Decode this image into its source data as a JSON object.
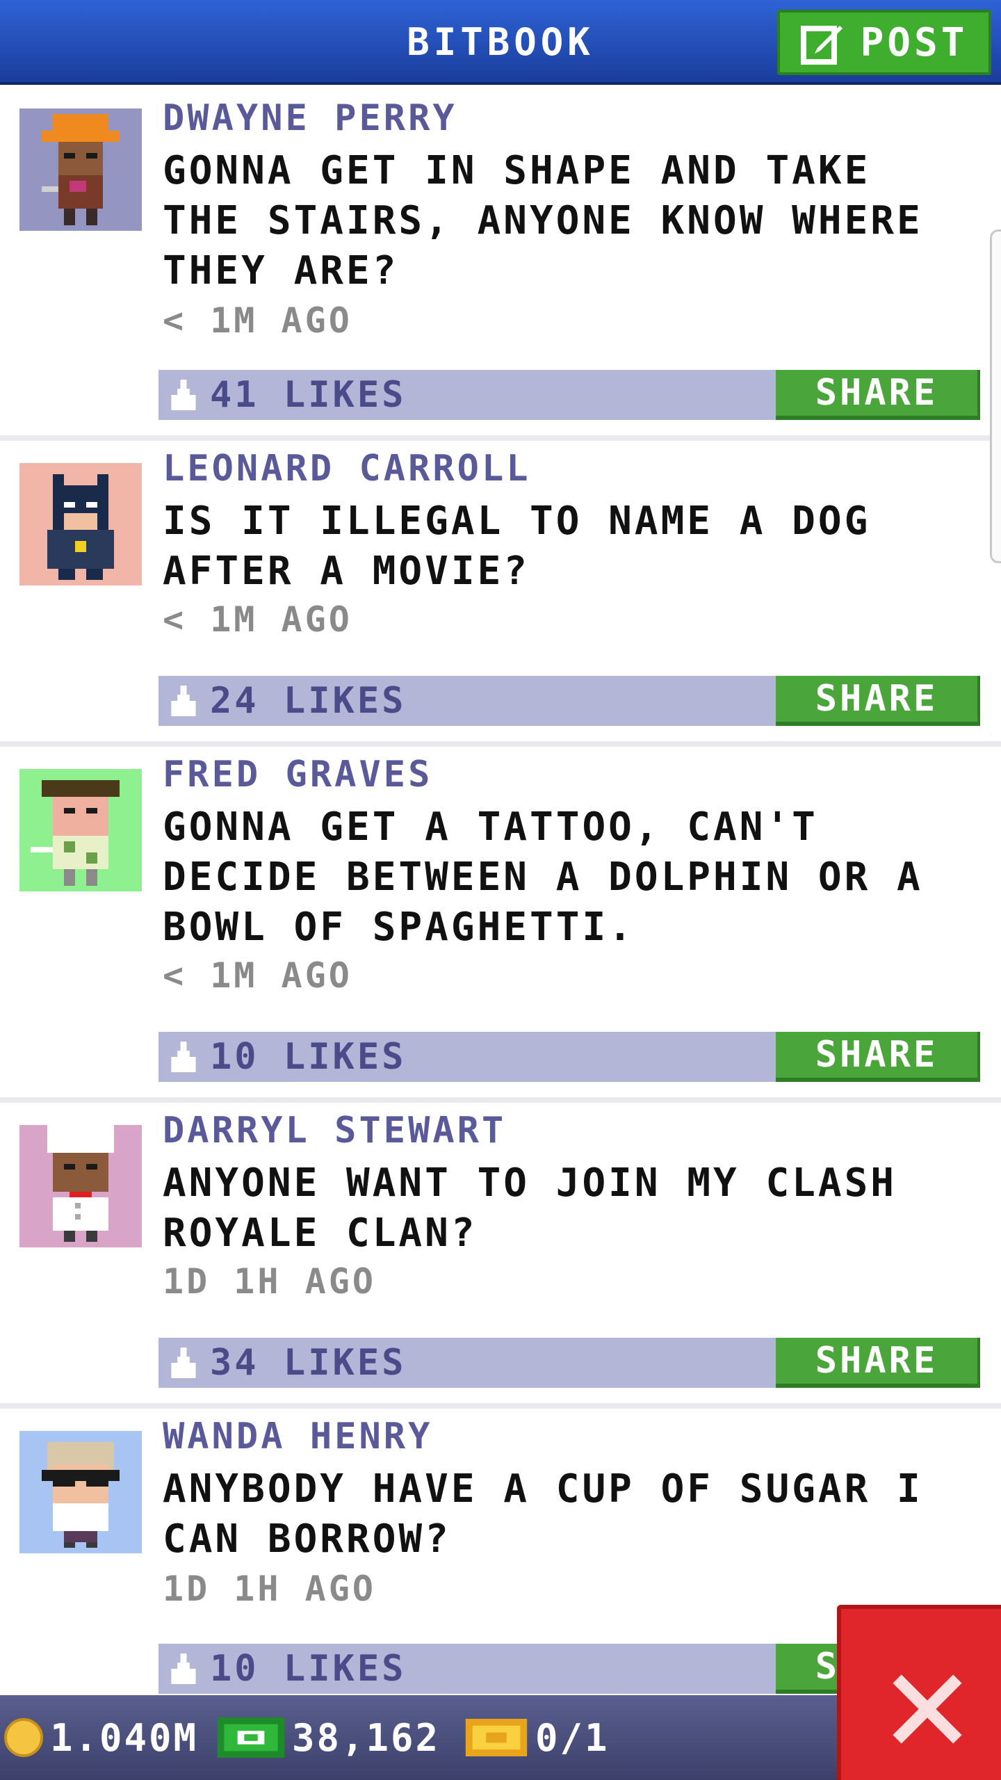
{
  "header": {
    "title": "BITBOOK",
    "post_label": "POST",
    "accent": "#2f63d6",
    "post_color": "#3fae2e"
  },
  "posts": [
    {
      "author": "DWAYNE PERRY",
      "message": "GONNA GET IN SHAPE AND TAKE THE STAIRS, ANYONE KNOW WHERE THEY ARE?",
      "time": "< 1M AGO",
      "likes": "41 LIKES",
      "share": "SHARE",
      "avatar_bg": "#9595c2"
    },
    {
      "author": "LEONARD CARROLL",
      "message": "IS IT ILLEGAL TO NAME A DOG AFTER A MOVIE?",
      "time": "< 1M AGO",
      "likes": "24 LIKES",
      "share": "SHARE",
      "avatar_bg": "#f2b6a8"
    },
    {
      "author": "FRED GRAVES",
      "message": "GONNA GET A TATTOO, CAN'T DECIDE BETWEEN A DOLPHIN OR A BOWL OF SPAGHETTI.",
      "time": "< 1M AGO",
      "likes": "10 LIKES",
      "share": "SHARE",
      "avatar_bg": "#8ef08e"
    },
    {
      "author": "DARRYL STEWART",
      "message": "ANYONE WANT TO JOIN MY CLASH ROYALE CLAN?",
      "time": "1D 1H AGO",
      "likes": "34 LIKES",
      "share": "SHARE",
      "avatar_bg": "#d8a4c8"
    },
    {
      "author": "WANDA HENRY",
      "message": "ANYBODY HAVE A CUP OF SUGAR I CAN BORROW?",
      "time": "1D 1H AGO",
      "likes": "10 LIKES",
      "share": "SHARE",
      "avatar_bg": "#a8c4f2"
    }
  ],
  "status": {
    "coins": "1.040M",
    "cash": "38,162",
    "tickets": "0/1"
  },
  "icons": {
    "post": "edit-icon",
    "like": "thumbs-up-icon",
    "coin": "coin-icon",
    "cash": "cash-icon",
    "ticket": "ticket-icon",
    "close": "close-icon"
  },
  "colors": {
    "share_green": "#4aa53a",
    "likes_bar": "#b4b6d8",
    "close_red": "#e0262a"
  }
}
